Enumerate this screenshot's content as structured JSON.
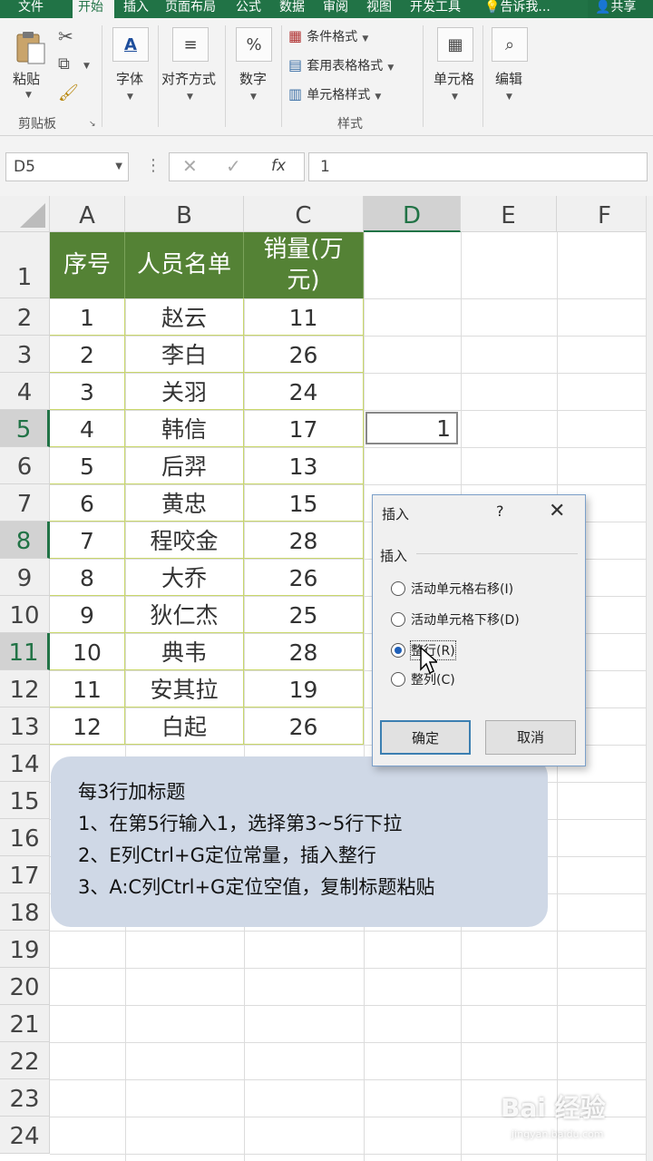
{
  "ribbon_tabs": {
    "file": "文件",
    "home": "开始",
    "insert": "插入",
    "layout": "页面布局",
    "formulas": "公式",
    "data": "数据",
    "review": "审阅",
    "view": "视图",
    "developer": "开发工具",
    "tell_me": "告诉我...",
    "share": "共享"
  },
  "ribbon": {
    "paste": "粘贴",
    "clipboard": "剪贴板",
    "font": "字体",
    "alignment": "对齐方式",
    "number": "数字",
    "conditional_format": "条件格式",
    "format_as_table": "套用表格格式",
    "cell_styles": "单元格样式",
    "styles": "样式",
    "cells": "单元格",
    "editing": "编辑",
    "font_icon": "A",
    "number_icon": "%"
  },
  "formula_bar": {
    "name_box": "D5",
    "fx": "fx",
    "value": "1"
  },
  "columns": [
    "A",
    "B",
    "C",
    "D",
    "E",
    "F"
  ],
  "rows": [
    "1",
    "2",
    "3",
    "4",
    "5",
    "6",
    "7",
    "8",
    "9",
    "10",
    "11",
    "12",
    "13",
    "14",
    "15",
    "16",
    "17",
    "18",
    "19",
    "20",
    "21",
    "22",
    "23",
    "24"
  ],
  "table": {
    "headers": [
      "序号",
      "人员名单",
      "销量(万",
      "元)"
    ],
    "data": [
      [
        "1",
        "赵云",
        "11"
      ],
      [
        "2",
        "李白",
        "26"
      ],
      [
        "3",
        "关羽",
        "24"
      ],
      [
        "4",
        "韩信",
        "17"
      ],
      [
        "5",
        "后羿",
        "13"
      ],
      [
        "6",
        "黄忠",
        "15"
      ],
      [
        "7",
        "程咬金",
        "28"
      ],
      [
        "8",
        "大乔",
        "26"
      ],
      [
        "9",
        "狄仁杰",
        "25"
      ],
      [
        "10",
        "典韦",
        "28"
      ],
      [
        "11",
        "安其拉",
        "19"
      ],
      [
        "12",
        "白起",
        "26"
      ]
    ]
  },
  "d5_value": "1",
  "dialog": {
    "title": "插入",
    "help": "?",
    "close": "✕",
    "group": "插入",
    "options": [
      "活动单元格右移(I)",
      "活动单元格下移(D)",
      "整行(R)",
      "整列(C)"
    ],
    "selected_option": "整行(R)",
    "ok": "确定",
    "cancel": "取消"
  },
  "note": [
    "每3行加标题",
    "1、在第5行输入1，选择第3~5行下拉",
    "2、E列Ctrl+G定位常量，插入整行",
    "3、A:C列Ctrl+G定位空值，复制标题粘贴"
  ],
  "watermark": {
    "main": "Bai 经验",
    "sub": "jingyan.baidu.com"
  },
  "colors": {
    "excel_green": "#217346",
    "header_fill": "#548235",
    "note_fill": "#cfd8e6"
  }
}
